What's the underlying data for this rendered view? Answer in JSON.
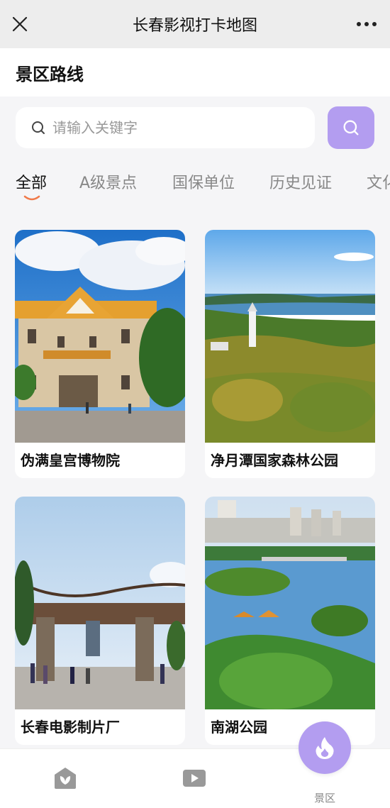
{
  "app": {
    "title": "长春影视打卡地图"
  },
  "section": {
    "title": "景区路线"
  },
  "search": {
    "placeholder": "请输入关键字"
  },
  "tabs": [
    {
      "label": "全部",
      "active": true
    },
    {
      "label": "A级景点",
      "active": false
    },
    {
      "label": "国保单位",
      "active": false
    },
    {
      "label": "历史见证",
      "active": false
    },
    {
      "label": "文化",
      "active": false
    }
  ],
  "cards": [
    {
      "name": "伪满皇宫博物院",
      "image": "palace-photo"
    },
    {
      "name": "净月潭国家森林公园",
      "image": "forest-park-photo"
    },
    {
      "name": "长春电影制片厂",
      "image": "film-studio-gate-photo"
    },
    {
      "name": "南湖公园",
      "image": "nanhu-park-photo"
    }
  ],
  "bottom_nav": [
    {
      "icon": "leaf-home-icon",
      "label": ""
    },
    {
      "icon": "video-play-icon",
      "label": ""
    },
    {
      "icon": "flame-icon",
      "label": "景区"
    }
  ],
  "colors": {
    "accent": "#b39df0",
    "tab_underline": "#f07a4a"
  }
}
